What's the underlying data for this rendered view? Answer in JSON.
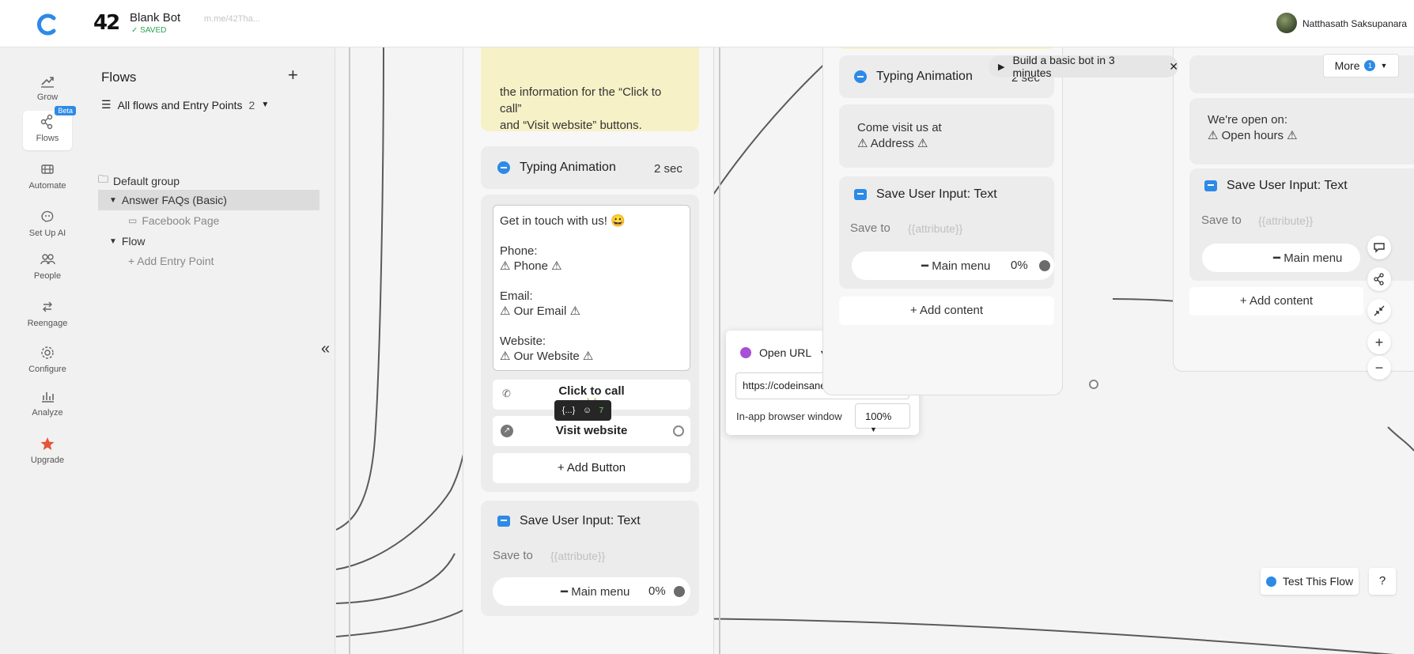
{
  "header": {
    "bot_name": "Blank Bot",
    "bot_status": "SAVED",
    "bot_link": "m.me/42Tha...",
    "bot_logo_text": "42",
    "user_name": "Natthasath Saksupanara"
  },
  "rail": {
    "items": [
      {
        "label": "Grow",
        "icon": "grow-icon"
      },
      {
        "label": "Flows",
        "icon": "flows-icon",
        "badge": "Beta",
        "active": true
      },
      {
        "label": "Automate",
        "icon": "automate-icon"
      },
      {
        "label": "Set Up AI",
        "icon": "ai-icon"
      },
      {
        "label": "People",
        "icon": "people-icon"
      },
      {
        "label": "Reengage",
        "icon": "reengage-icon"
      },
      {
        "label": "Configure",
        "icon": "gear-icon"
      },
      {
        "label": "Analyze",
        "icon": "chart-icon"
      },
      {
        "label": "Upgrade",
        "icon": "star-icon"
      }
    ]
  },
  "flows_panel": {
    "title": "Flows",
    "add": "+",
    "filter_label": "All flows and Entry Points",
    "filter_count": "2",
    "tree": {
      "group": "Default group",
      "flow1": "Answer FAQs (Basic)",
      "flow1_entry": "Facebook Page",
      "flow2": "Flow",
      "add_entry": "+ Add Entry Point"
    },
    "collapse": "«"
  },
  "canvas": {
    "note_text_1": "the information for the “Click to call”",
    "note_text_2": "and “Visit website” buttons.",
    "col1": {
      "typing_title": "Typing Animation",
      "typing_duration": "2 sec",
      "message_lines": [
        "Get in touch with us! 😀",
        "",
        "Phone:",
        "⚠ Phone ⚠",
        "",
        "Email:",
        "⚠ Our Email ⚠",
        "",
        "Website:",
        "⚠ Our Website ⚠"
      ],
      "btn_call": "Click to call",
      "btn_call_warn": "⚠⚠",
      "btn_website": "Visit website",
      "btn_add": "+ Add Button",
      "save_title": "Save User Input: Text",
      "save_to": "Save to",
      "attr": "{{attribute}}",
      "menu": "━ Main menu",
      "menu_pct": "0%"
    },
    "col2": {
      "typing_title": "Typing Animation",
      "typing_duration": "2 sec",
      "msg_line1": "Come visit us at",
      "msg_line2": "⚠ Address ⚠",
      "save_title": "Save User Input: Text",
      "save_to": "Save to",
      "attr": "{{attribute}}",
      "menu": "━ Main menu",
      "menu_pct": "0%",
      "add_content": "+ Add content"
    },
    "col3": {
      "msg_line1": "We're open on:",
      "msg_line2": "⚠ Open hours ⚠",
      "save_title": "Save User Input: Text",
      "save_to": "Save to",
      "attr": "{{attribute}}",
      "menu": "━ Main menu",
      "add_content": "+ Add content"
    },
    "popover": {
      "action": "Open URL",
      "url": "https://codeinsane.wordpress.com/",
      "browser_label": "In-app browser window",
      "browser_value": "100%"
    },
    "mini_toolbar": {
      "vars": "{...}",
      "count": "7"
    },
    "tour": {
      "label": "Build a basic bot in 3 minutes",
      "close": "✕"
    },
    "more": {
      "label": "More",
      "badge": "1"
    },
    "zoom_in": "+",
    "zoom_out": "−",
    "test_flow": "Test This Flow",
    "help": "?"
  },
  "colors": {
    "accent": "#2d8ae6",
    "note_bg": "#f7f1c7",
    "warning": "#c79b00",
    "upgrade": "#e5553b",
    "saved_green": "#2da44e"
  }
}
